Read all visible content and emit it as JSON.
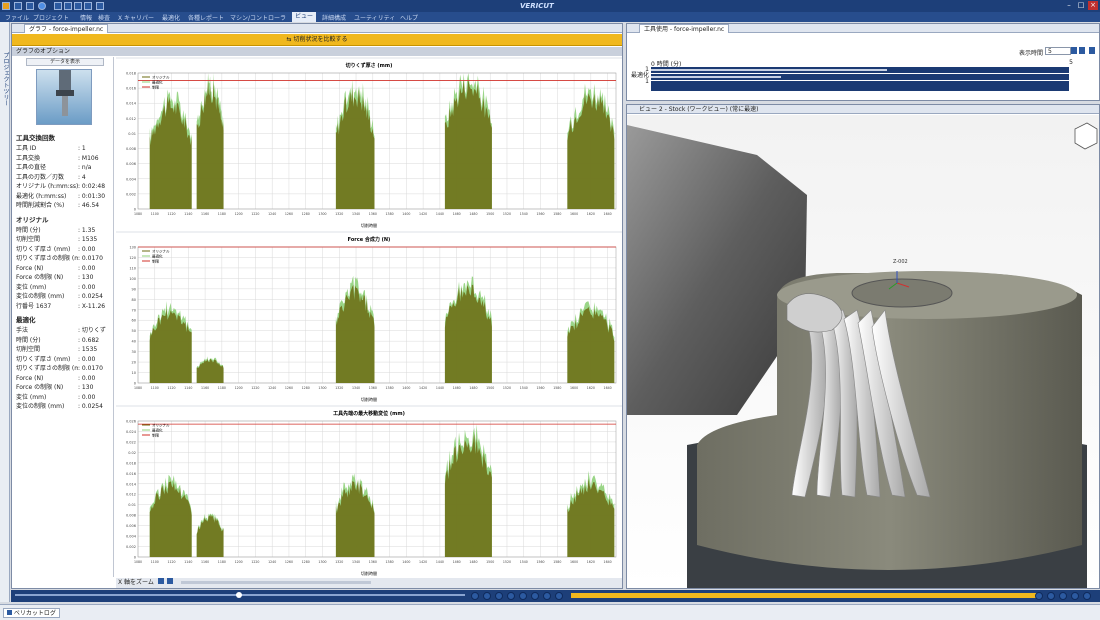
{
  "app_title": "VERICUT",
  "menu": [
    "ファイル",
    "プロジェクト",
    "情報",
    "検査",
    "X キャリパー",
    "最適化",
    "各種レポート",
    "マシン/コントローラ",
    "ビュー",
    "詳細構成",
    "ユーティリティ",
    "ヘルプ"
  ],
  "menu_active": "ビュー",
  "left_strip": "プロジェクトツリー",
  "graph_panel": {
    "title": "グラフ - force-impeller.nc",
    "yellow_button": "切削状況を比較する",
    "options_label": "グラフのオプション",
    "show_data": "データを表示",
    "tool_section": "工具交換回数",
    "tool_rows": [
      {
        "k": "工具 ID",
        "v": ": 1"
      },
      {
        "k": "工具交換",
        "v": ": M106"
      },
      {
        "k": "工具の直径",
        "v": ": n/a"
      },
      {
        "k": "工具の刃数／刃数",
        "v": ": 4"
      },
      {
        "k": "オリジナル (h:mm:ss)",
        "v": ": 0:02:48"
      },
      {
        "k": "最適化 (h:mm:ss)",
        "v": ": 0:01:30"
      },
      {
        "k": "時間削減割合 (%)",
        "v": ": 46.54"
      }
    ],
    "orig_section": "オリジナル",
    "orig_rows": [
      {
        "k": "時間 (分)",
        "v": ": 1.35"
      },
      {
        "k": "切削空間",
        "v": ": 1535"
      },
      {
        "k": "切りくず厚さ (mm)",
        "v": ": 0.00"
      },
      {
        "k": "切りくず厚さの制限 (mm)",
        "v": ": 0.0170"
      },
      {
        "k": "Force (N)",
        "v": ": 0.00"
      },
      {
        "k": "Force の制限 (N)",
        "v": ": 130"
      },
      {
        "k": "変位 (mm)",
        "v": ": 0.00"
      },
      {
        "k": "変位の制限 (mm)",
        "v": ": 0.0254"
      },
      {
        "k": "行番号 1637",
        "v": ": X-11.26"
      }
    ],
    "opt_section": "最適化",
    "opt_rows": [
      {
        "k": "手法",
        "v": ": 切りくず"
      },
      {
        "k": "時間 (分)",
        "v": ": 0.682"
      },
      {
        "k": "切削空間",
        "v": ": 1535"
      },
      {
        "k": "切りくず厚さ (mm)",
        "v": ": 0.00"
      },
      {
        "k": "切りくず厚さの制限 (mm)",
        "v": ": 0.0170"
      },
      {
        "k": "Force (N)",
        "v": ": 0.00"
      },
      {
        "k": "Force の制限 (N)",
        "v": ": 130"
      },
      {
        "k": "変位 (mm)",
        "v": ": 0.00"
      },
      {
        "k": "変位の制限 (mm)",
        "v": ": 0.0254"
      }
    ],
    "zoom_label": "X 軸をズーム"
  },
  "chart_data": [
    {
      "type": "area",
      "title": "切りくず厚さ (mm)",
      "xlabel": "切削時間",
      "ylim": [
        0,
        0.018
      ],
      "yticks": [
        "0",
        "0.002",
        "0.004",
        "0.006",
        "0.008",
        "0.01",
        "0.012",
        "0.014",
        "0.016",
        "0.018"
      ],
      "legend": [
        "オリジナル",
        "最適化",
        "制限"
      ],
      "limit": 0.017
    },
    {
      "type": "area",
      "title": "Force 合成力 (N)",
      "xlabel": "切削時間",
      "ylim": [
        0,
        130
      ],
      "yticks": [
        "0",
        "10",
        "20",
        "30",
        "40",
        "50",
        "60",
        "70",
        "80",
        "90",
        "100",
        "110",
        "120",
        "130"
      ],
      "legend": [
        "オリジナル",
        "最適化",
        "制限"
      ],
      "limit": 130
    },
    {
      "type": "area",
      "title": "工具先端の最大移動変位 (mm)",
      "xlabel": "切削時間",
      "ylim": [
        0,
        0.026
      ],
      "yticks": [
        "0",
        "0.002",
        "0.004",
        "0.006",
        "0.008",
        "0.01",
        "0.012",
        "0.014",
        "0.016",
        "0.018",
        "0.02",
        "0.022",
        "0.024",
        "0.026"
      ],
      "legend": [
        "オリジナル",
        "最適化",
        "制限"
      ],
      "limit": 0.0254
    }
  ],
  "xticks": [
    "1080",
    "1100",
    "1120",
    "1140",
    "1160",
    "1180",
    "1200",
    "1220",
    "1240",
    "1260",
    "1280",
    "1300",
    "1320",
    "1340",
    "1360",
    "1380",
    "1400",
    "1420",
    "1440",
    "1460",
    "1480",
    "1500",
    "1520",
    "1540",
    "1560",
    "1580",
    "1600",
    "1620",
    "1640"
  ],
  "tool_panel": {
    "title": "工具使用 - force-impeller.nc",
    "time_label": "表示時間",
    "time_value": "5",
    "zero_label": "0 時間 (分)",
    "max_label": "5",
    "row1": "1",
    "row2": "最適化 1"
  },
  "view_panel": {
    "title": "ビュー 2 - Stock (ワークビュー) (常に最速)",
    "axis_label": "Z-002"
  },
  "bottom_tab": "ベリカットログ",
  "colors": {
    "orig": "#6b6b12",
    "opt": "#8fd07a",
    "limit": "#d0302a"
  }
}
